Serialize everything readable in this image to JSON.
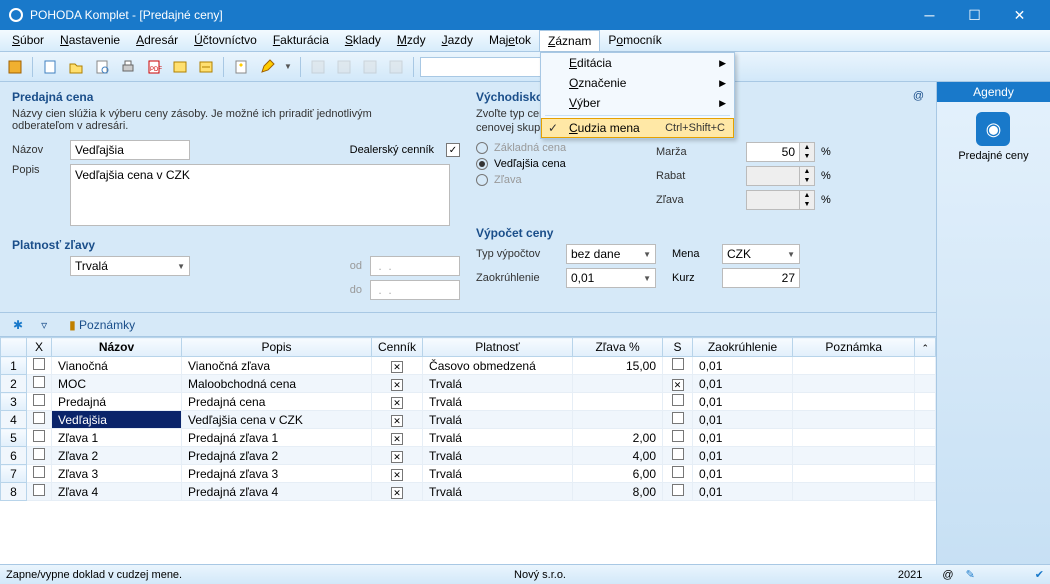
{
  "window": {
    "title": "POHODA Komplet - [Predajné ceny]"
  },
  "menus": [
    "Súbor",
    "Nastavenie",
    "Adresár",
    "Účtovníctvo",
    "Fakturácia",
    "Sklady",
    "Mzdy",
    "Jazdy",
    "Majetok",
    "Záznam",
    "Pomocník"
  ],
  "menu_underline_idx": [
    0,
    0,
    0,
    0,
    0,
    0,
    0,
    0,
    3,
    0,
    1
  ],
  "zaznam_menu": {
    "items": [
      "Editácia",
      "Označenie",
      "Výber"
    ],
    "special": {
      "label": "Cudzia mena",
      "shortcut": "Ctrl+Shift+C",
      "checked": true
    }
  },
  "form": {
    "left": {
      "title": "Predajná cena",
      "desc": "Názvy cien slúžia k výberu ceny zásoby. Je možné ich priradiť jednotlivým odberateľom v adresári.",
      "nazov_label": "Názov",
      "nazov": "Vedľajšia",
      "dealer_label": "Dealerský cenník",
      "dealer_checked": true,
      "popis_label": "Popis",
      "popis": "Vedľajšia cena v CZK",
      "platnost_title": "Platnosť zľavy",
      "platnost": "Trvalá",
      "od": "od",
      "do": "do",
      "od_val": " .  .",
      "do_val": " .  ."
    },
    "right": {
      "title": "Východiskové na",
      "desc": "Zvoľte typ ceny.",
      "desc2": "enenie novej cenovej skupiny, kue ich mozete upravit.",
      "desc2_full": "cenovej skupiny, kde ich môžete upraviť.",
      "radios": {
        "zakladna": "Základná cena",
        "vedlajsia": "Vedľajšia cena",
        "zlava": "Zľava",
        "selected": "vedlajsia"
      },
      "marza": "Marža",
      "marza_val": "50",
      "rabat": "Rabat",
      "rabat_val": "",
      "zlava_lab": "Zľava",
      "zlava_val": "",
      "vypocet_title": "Výpočet ceny",
      "typ_label": "Typ výpočtov",
      "typ_val": "bez dane",
      "mena_label": "Mena",
      "mena_val": "CZK",
      "zaokr_label": "Zaokrúhlenie",
      "zaokr_val": "0,01",
      "kurz_label": "Kurz",
      "kurz_val": "27",
      "at": "@",
      "pct": "%"
    }
  },
  "grid": {
    "tab_poznamky": "Poznámky",
    "headers": [
      "",
      "X",
      "Názov",
      "Popis",
      "Cenník",
      "Platnosť",
      "Zľava %",
      "S",
      "Zaokrúhlenie",
      "Poznámka"
    ],
    "rows": [
      {
        "n": "1",
        "x": false,
        "nazov": "Vianočná",
        "popis": "Vianočná zľava",
        "cennik": true,
        "platnost": "Časovo obmedzená",
        "zlava": "15,00",
        "s": false,
        "zaokr": "0,01",
        "pozn": ""
      },
      {
        "n": "2",
        "x": false,
        "nazov": "MOC",
        "popis": "Maloobchodná cena",
        "cennik": true,
        "platnost": "Trvalá",
        "zlava": "",
        "s": true,
        "zaokr": "0,01",
        "pozn": ""
      },
      {
        "n": "3",
        "x": false,
        "nazov": "Predajná",
        "popis": "Predajná cena",
        "cennik": true,
        "platnost": "Trvalá",
        "zlava": "",
        "s": false,
        "zaokr": "0,01",
        "pozn": ""
      },
      {
        "n": "4",
        "x": false,
        "nazov": "Vedľajšia",
        "popis": "Vedľajšia cena v CZK",
        "cennik": true,
        "platnost": "Trvalá",
        "zlava": "",
        "s": false,
        "zaokr": "0,01",
        "pozn": ""
      },
      {
        "n": "5",
        "x": false,
        "nazov": "Zľava 1",
        "popis": "Predajná zľava 1",
        "cennik": true,
        "platnost": "Trvalá",
        "zlava": "2,00",
        "s": false,
        "zaokr": "0,01",
        "pozn": ""
      },
      {
        "n": "6",
        "x": false,
        "nazov": "Zľava 2",
        "popis": "Predajná zľava 2",
        "cennik": true,
        "platnost": "Trvalá",
        "zlava": "4,00",
        "s": false,
        "zaokr": "0,01",
        "pozn": ""
      },
      {
        "n": "7",
        "x": false,
        "nazov": "Zľava 3",
        "popis": "Predajná zľava 3",
        "cennik": true,
        "platnost": "Trvalá",
        "zlava": "6,00",
        "s": false,
        "zaokr": "0,01",
        "pozn": ""
      },
      {
        "n": "8",
        "x": false,
        "nazov": "Zľava 4",
        "popis": "Predajná zľava 4",
        "cennik": true,
        "platnost": "Trvalá",
        "zlava": "8,00",
        "s": false,
        "zaokr": "0,01",
        "pozn": ""
      }
    ],
    "selected_row": 3
  },
  "sidebar": {
    "header": "Agendy",
    "item": "Predajné ceny"
  },
  "status": {
    "left": "Zapne/vypne doklad v cudzej mene.",
    "mid": "Nový s.r.o.",
    "year": "2021",
    "at": "@"
  }
}
